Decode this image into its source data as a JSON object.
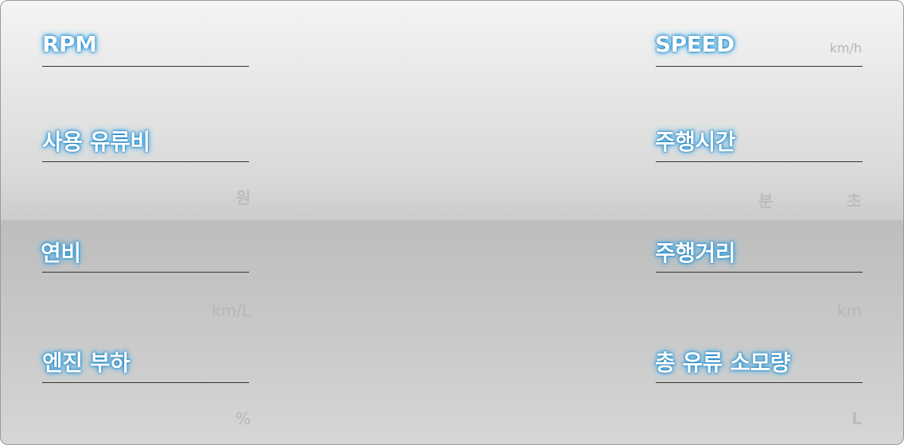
{
  "left": {
    "rpm_label": "RPM",
    "fuel_cost_label": "사용 유류비",
    "fuel_cost_unit": "원",
    "efficiency_label": "연비",
    "efficiency_unit": "km/L",
    "engine_load_label": "엔진 부하",
    "engine_load_unit": "%"
  },
  "right": {
    "speed_label": "SPEED",
    "speed_unit": "km/h",
    "drive_time_label": "주행시간",
    "minutes_unit": "분",
    "seconds_unit": "초",
    "distance_label": "주행거리",
    "distance_unit": "km",
    "fuel_total_label": "총 유류 소모량",
    "fuel_total_unit": "L"
  },
  "colors": {
    "label_text": "#ffffff",
    "label_glow": "#3aa7e8",
    "unit_text": "#b6b6b6",
    "divider": "#333333"
  }
}
